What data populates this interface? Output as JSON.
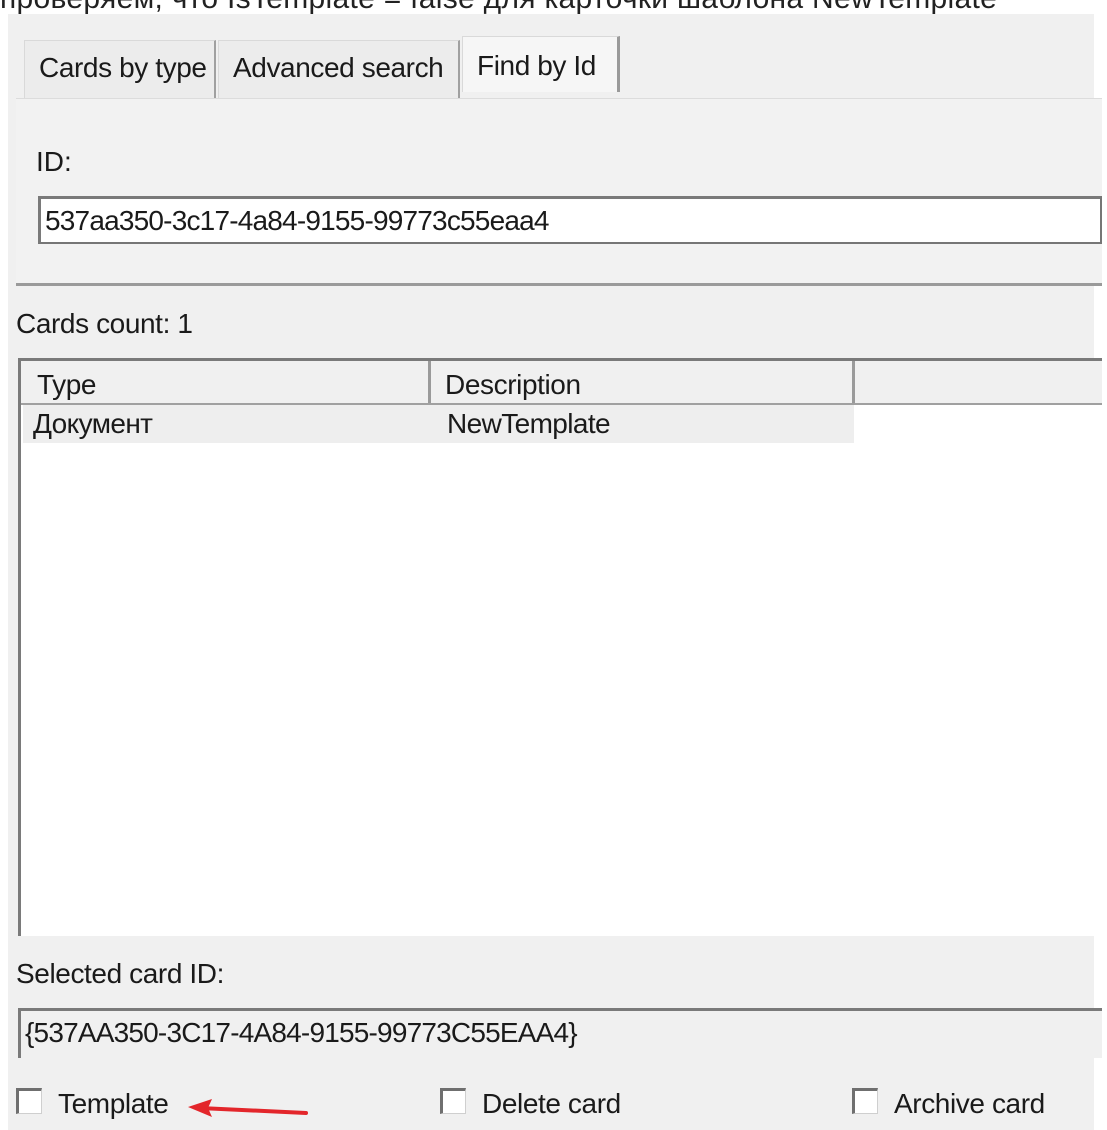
{
  "clipped_top_text": "проверяем, что IsTemplate = false для карточки шаблона NewTemplate",
  "tabs": [
    {
      "label": "Cards by type",
      "active": false
    },
    {
      "label": "Advanced search",
      "active": false
    },
    {
      "label": "Find by Id",
      "active": true
    }
  ],
  "find_by_id": {
    "label": "ID:",
    "value": "537aa350-3c17-4a84-9155-99773c55eaa4"
  },
  "cards_count": "Cards count: 1",
  "grid": {
    "columns": [
      "Type",
      "Description"
    ],
    "rows": [
      {
        "type": "Документ",
        "description": "NewTemplate"
      }
    ]
  },
  "selected_card": {
    "label": "Selected card ID:",
    "value": "{537AA350-3C17-4A84-9155-99773C55EAA4}"
  },
  "checkboxes": [
    {
      "label": "Template",
      "checked": false
    },
    {
      "label": "Delete card",
      "checked": false
    },
    {
      "label": "Archive card",
      "checked": false
    }
  ],
  "annotation": {
    "arrow_color": "#e3262b"
  }
}
